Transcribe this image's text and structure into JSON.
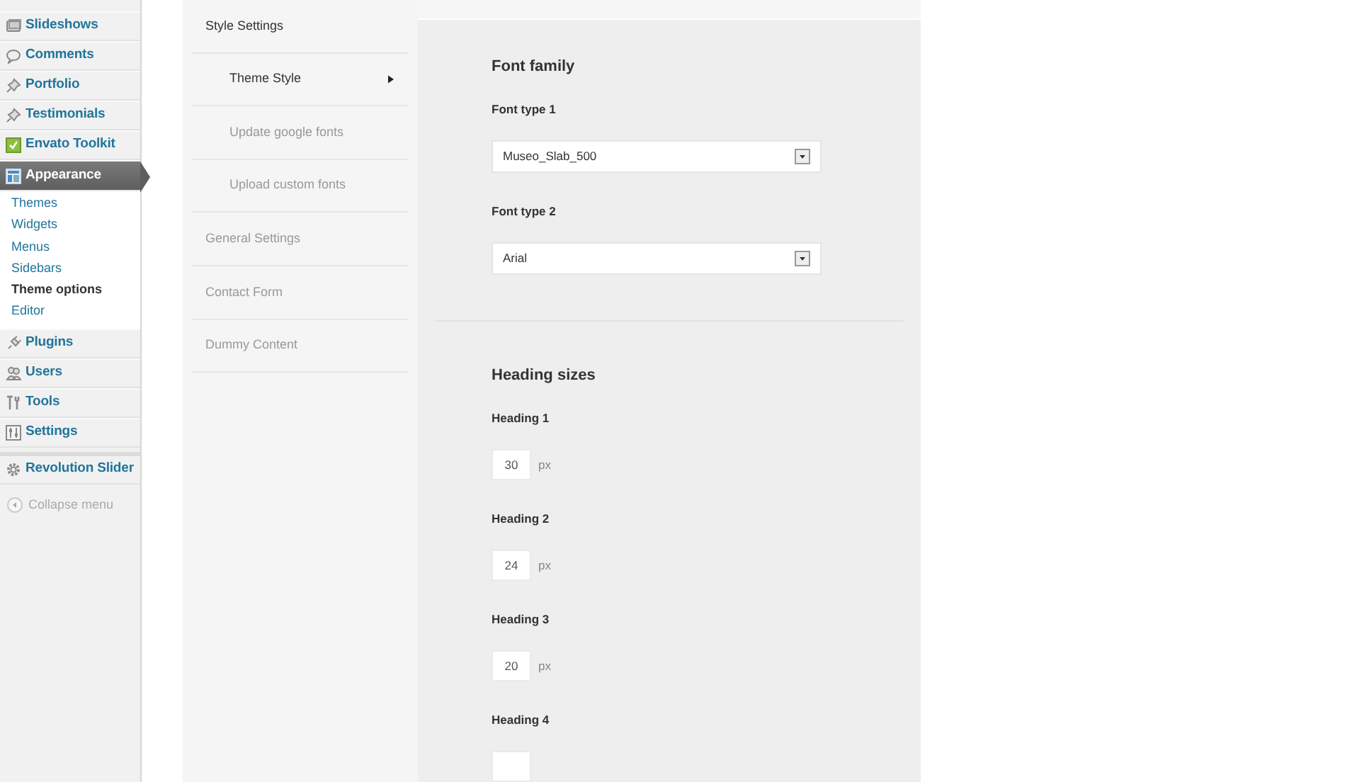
{
  "admin_menu": {
    "items": [
      {
        "label": "Slideshows",
        "selected": false
      },
      {
        "label": "Comments",
        "selected": false
      },
      {
        "label": "Portfolio",
        "selected": false
      },
      {
        "label": "Testimonials",
        "selected": false
      },
      {
        "label": "Envato Toolkit",
        "selected": false
      },
      {
        "label": "Appearance",
        "selected": true,
        "submenu": [
          {
            "label": "Themes",
            "selected": false
          },
          {
            "label": "Widgets",
            "selected": false
          },
          {
            "label": "Menus",
            "selected": false
          },
          {
            "label": "Sidebars",
            "selected": false
          },
          {
            "label": "Theme options",
            "selected": true
          },
          {
            "label": "Editor",
            "selected": false
          }
        ]
      },
      {
        "label": "Plugins",
        "selected": false
      },
      {
        "label": "Users",
        "selected": false
      },
      {
        "label": "Tools",
        "selected": false
      },
      {
        "label": "Settings",
        "selected": false
      },
      {
        "label": "Revolution Slider",
        "selected": false,
        "separated": true
      }
    ],
    "collapse": {
      "label": "Collapse menu"
    }
  },
  "options_nav": [
    {
      "label": "Style Settings",
      "expanded": true,
      "children": [
        {
          "label": "Theme Style",
          "selected": true
        },
        {
          "label": "Update google fonts",
          "selected": false
        },
        {
          "label": "Upload custom fonts",
          "selected": false
        }
      ]
    },
    {
      "label": "General Settings",
      "expanded": false
    },
    {
      "label": "Contact Form",
      "expanded": false
    },
    {
      "label": "Dummy Content",
      "expanded": false
    }
  ],
  "sections": [
    {
      "title": "Font family",
      "fields": [
        {
          "kind": "select",
          "label": "Font type 1",
          "value": "Museo_Slab_500"
        },
        {
          "kind": "select",
          "label": "Font type 2",
          "value": "Arial"
        }
      ]
    },
    {
      "title": "Heading sizes",
      "fields": [
        {
          "kind": "size",
          "label": "Heading 1",
          "value": "30",
          "unit": "px"
        },
        {
          "kind": "size",
          "label": "Heading 2",
          "value": "24",
          "unit": "px"
        },
        {
          "kind": "size",
          "label": "Heading 3",
          "value": "20",
          "unit": "px"
        },
        {
          "kind": "size",
          "label": "Heading 4"
        }
      ]
    }
  ]
}
